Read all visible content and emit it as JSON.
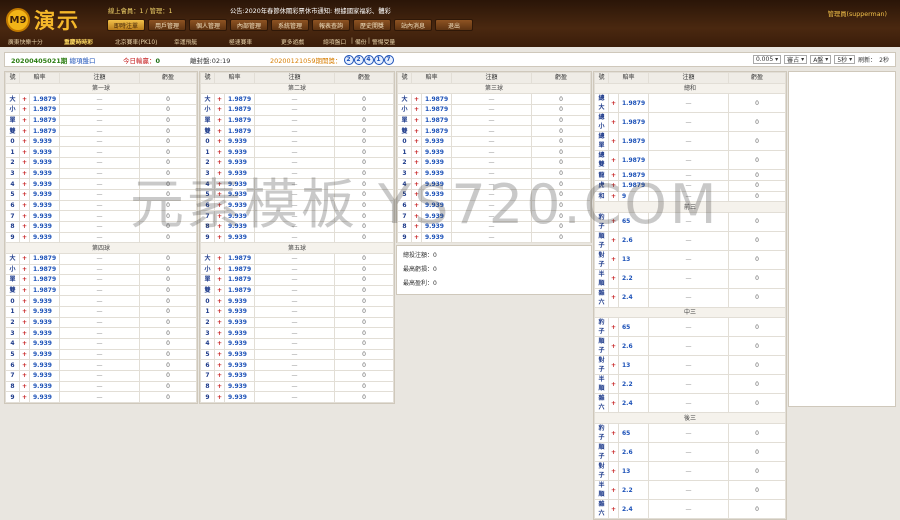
{
  "header": {
    "logo_badge": "M9",
    "logo_text": "演示",
    "online": "線上會員：1 / 管理：1",
    "notice": "公告:2020年春節休關彩票休市通知: 根據國家福彩、體彩",
    "user": "管理員(supperman)"
  },
  "mainnav": [
    "即時注單",
    "用戶管理",
    "個人管理",
    "內部管理",
    "系統管理",
    "報表查詢",
    "歷史開獎",
    "站內消息",
    "退出"
  ],
  "subnav": [
    "廣東快樂十分",
    "重慶時時彩",
    "北京賽車(PK10)",
    "幸運飛艇",
    "極速賽車",
    "更多遊戲",
    "總項盤口",
    "備份",
    "警惕受量"
  ],
  "bar": {
    "issue": "20200405021期",
    "issue_link": "總項盤口",
    "profit_label": "今日輸贏：",
    "profit": "0",
    "close": "離封盤:02:19",
    "prev": "20200121059期開獎：",
    "balls": [
      "2",
      "2",
      "4",
      "1",
      "7"
    ],
    "bet": "0.005",
    "mode": "審占",
    "plate": "A盤",
    "secs": "5秒",
    "refresh": "刷新：",
    "remain": "2秒"
  },
  "cols": {
    "no": "號",
    "odds": "賠率",
    "bets": "注額",
    "gain": "虧盈"
  },
  "labels": {
    "first": "第一球",
    "second": "第二球",
    "third": "第三球",
    "fourth": "第四球",
    "fifth": "第五球",
    "sum": "總和",
    "front3": "前三",
    "mid3": "中三",
    "back3": "後三"
  },
  "ball_rows": [
    {
      "n": "大",
      "o": "1.9879"
    },
    {
      "n": "小",
      "o": "1.9879"
    },
    {
      "n": "單",
      "o": "1.9879"
    },
    {
      "n": "雙",
      "o": "1.9879"
    },
    {
      "n": "0",
      "o": "9.939"
    },
    {
      "n": "1",
      "o": "9.939"
    },
    {
      "n": "2",
      "o": "9.939"
    },
    {
      "n": "3",
      "o": "9.939"
    },
    {
      "n": "4",
      "o": "9.939"
    },
    {
      "n": "5",
      "o": "9.939"
    },
    {
      "n": "6",
      "o": "9.939"
    },
    {
      "n": "7",
      "o": "9.939"
    },
    {
      "n": "8",
      "o": "9.939"
    },
    {
      "n": "9",
      "o": "9.939"
    }
  ],
  "sum_rows": [
    {
      "n": "總大",
      "o": "1.9879"
    },
    {
      "n": "總小",
      "o": "1.9879"
    },
    {
      "n": "總單",
      "o": "1.9879"
    },
    {
      "n": "總雙",
      "o": "1.9879"
    },
    {
      "n": "龍",
      "o": "1.9879"
    },
    {
      "n": "虎",
      "o": "1.9879"
    },
    {
      "n": "和",
      "o": "9"
    }
  ],
  "trio_rows": [
    {
      "n": "豹子",
      "o": "65"
    },
    {
      "n": "順子",
      "o": "2.6"
    },
    {
      "n": "對子",
      "o": "13"
    },
    {
      "n": "半順",
      "o": "2.2"
    },
    {
      "n": "雜六",
      "o": "2.4"
    }
  ],
  "dash": "—",
  "zero": "0",
  "stats": [
    "總投注額：0",
    "最高虧損：0",
    "最高盈利：0"
  ],
  "watermark": "元素模板 YS720.COM"
}
